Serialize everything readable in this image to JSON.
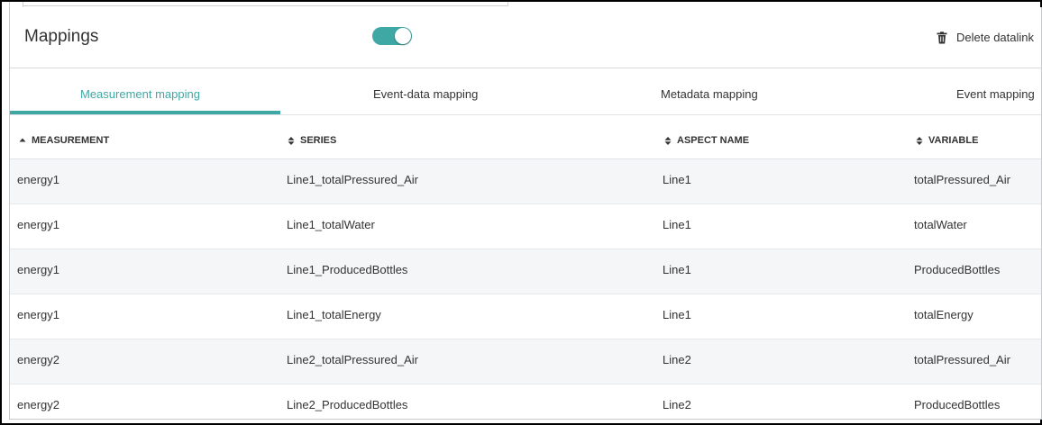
{
  "header": {
    "title": "Mappings",
    "toggle_state": "on",
    "delete_label": "Delete datalink",
    "delete_icon": "trash-icon"
  },
  "colors": {
    "accent": "#3fa8a4",
    "row_alt": "#f5f6f7"
  },
  "tabs": [
    {
      "label": "Measurement mapping",
      "active": true
    },
    {
      "label": "Event-data mapping",
      "active": false
    },
    {
      "label": "Metadata mapping",
      "active": false
    },
    {
      "label": "Event mapping",
      "active": false
    }
  ],
  "table": {
    "columns": [
      {
        "label": "MEASUREMENT",
        "sort": "ascending",
        "icon": "sort-asc-icon"
      },
      {
        "label": "SERIES",
        "sort": "none",
        "icon": "sort-both-icon"
      },
      {
        "label": "ASPECT NAME",
        "sort": "none",
        "icon": "sort-both-icon"
      },
      {
        "label": "VARIABLE",
        "sort": "none",
        "icon": "sort-both-icon"
      }
    ],
    "rows": [
      [
        "energy1",
        "Line1_totalPressured_Air",
        "Line1",
        "totalPressured_Air"
      ],
      [
        "energy1",
        "Line1_totalWater",
        "Line1",
        "totalWater"
      ],
      [
        "energy1",
        "Line1_ProducedBottles",
        "Line1",
        "ProducedBottles"
      ],
      [
        "energy1",
        "Line1_totalEnergy",
        "Line1",
        "totalEnergy"
      ],
      [
        "energy2",
        "Line2_totalPressured_Air",
        "Line2",
        "totalPressured_Air"
      ],
      [
        "energy2",
        "Line2_ProducedBottles",
        "Line2",
        "ProducedBottles"
      ]
    ]
  }
}
